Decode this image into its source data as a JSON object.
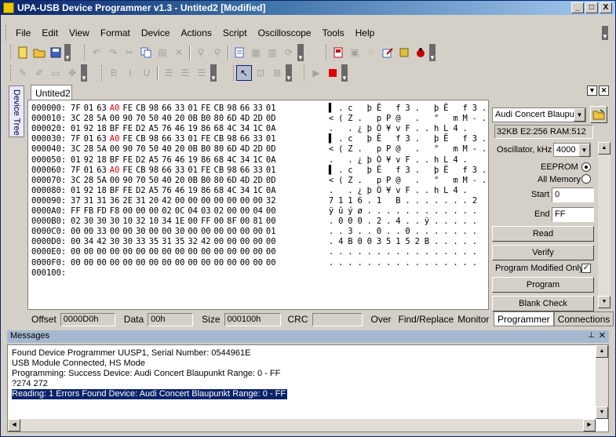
{
  "window": {
    "title": "UPA-USB Device Programmer v1.3 - Untited2 [Modified]",
    "min": "_",
    "max": "□",
    "close": "X"
  },
  "menu": [
    "File",
    "Edit",
    "View",
    "Format",
    "Device",
    "Actions",
    "Script",
    "Oscilloscope",
    "Tools",
    "Help"
  ],
  "sidebar_tab": "Device Tree",
  "doc_tab": "Untited2",
  "hex": {
    "rows": [
      {
        "addr": "000000:",
        "bytes": [
          "7F",
          "01",
          "63",
          "A0",
          "FE",
          "CB",
          "98",
          "66",
          "33",
          "01",
          "FE",
          "CB",
          "98",
          "66",
          "33",
          "01"
        ],
        "hl": [
          3
        ],
        "ascii": [
          "▌",
          ".",
          "c",
          " ",
          "þ",
          "Ë",
          " ",
          "f",
          "3",
          ".",
          " ",
          "þ",
          "Ë",
          " ",
          "f",
          "3",
          "."
        ]
      },
      {
        "addr": "000010:",
        "bytes": [
          "3C",
          "28",
          "5A",
          "00",
          "90",
          "70",
          "50",
          "40",
          "20",
          "0B",
          "B0",
          "80",
          "6D",
          "4D",
          "2D",
          "0D"
        ],
        "hl": [],
        "ascii": [
          "<",
          "(",
          "Z",
          ".",
          " ",
          "p",
          "P",
          "@",
          " ",
          ".",
          " ",
          "°",
          " ",
          "m",
          "M",
          "-",
          "."
        ]
      },
      {
        "addr": "000020:",
        "bytes": [
          "01",
          "92",
          "18",
          "BF",
          "FE",
          "D2",
          "A5",
          "76",
          "46",
          "19",
          "86",
          "68",
          "4C",
          "34",
          "1C",
          "0A"
        ],
        "hl": [],
        "ascii": [
          ".",
          " ",
          ".",
          "¿",
          "þ",
          "Ò",
          "¥",
          "v",
          "F",
          ".",
          ".",
          "h",
          "L",
          "4",
          ".",
          " "
        ]
      },
      {
        "addr": "000030:",
        "bytes": [
          "7F",
          "01",
          "63",
          "A0",
          "FE",
          "CB",
          "98",
          "66",
          "33",
          "01",
          "FE",
          "CB",
          "98",
          "66",
          "33",
          "01"
        ],
        "hl": [
          3
        ],
        "ascii": [
          "▌",
          ".",
          "c",
          " ",
          "þ",
          "Ë",
          " ",
          "f",
          "3",
          ".",
          " ",
          "þ",
          "Ë",
          " ",
          "f",
          "3",
          "."
        ]
      },
      {
        "addr": "000040:",
        "bytes": [
          "3C",
          "28",
          "5A",
          "00",
          "90",
          "70",
          "50",
          "40",
          "20",
          "0B",
          "B0",
          "80",
          "6D",
          "4D",
          "2D",
          "0D"
        ],
        "hl": [],
        "ascii": [
          "<",
          "(",
          "Z",
          ".",
          " ",
          "p",
          "P",
          "@",
          " ",
          ".",
          " ",
          "°",
          " ",
          "m",
          "M",
          "-",
          "."
        ]
      },
      {
        "addr": "000050:",
        "bytes": [
          "01",
          "92",
          "18",
          "BF",
          "FE",
          "D2",
          "A5",
          "76",
          "46",
          "19",
          "86",
          "68",
          "4C",
          "34",
          "1C",
          "0A"
        ],
        "hl": [],
        "ascii": [
          ".",
          " ",
          ".",
          "¿",
          "þ",
          "Ò",
          "¥",
          "v",
          "F",
          ".",
          ".",
          "h",
          "L",
          "4",
          ".",
          " "
        ]
      },
      {
        "addr": "000060:",
        "bytes": [
          "7F",
          "01",
          "63",
          "A0",
          "FE",
          "CB",
          "98",
          "66",
          "33",
          "01",
          "FE",
          "CB",
          "98",
          "66",
          "33",
          "01"
        ],
        "hl": [
          3
        ],
        "ascii": [
          "▌",
          ".",
          "c",
          " ",
          "þ",
          "Ë",
          " ",
          "f",
          "3",
          ".",
          " ",
          "þ",
          "Ë",
          " ",
          "f",
          "3",
          "."
        ]
      },
      {
        "addr": "000070:",
        "bytes": [
          "3C",
          "28",
          "5A",
          "00",
          "90",
          "70",
          "50",
          "40",
          "20",
          "0B",
          "B0",
          "80",
          "6D",
          "4D",
          "2D",
          "0D"
        ],
        "hl": [],
        "ascii": [
          "<",
          "(",
          "Z",
          ".",
          " ",
          "p",
          "P",
          "@",
          " ",
          ".",
          " ",
          "°",
          " ",
          "m",
          "M",
          "-",
          "."
        ]
      },
      {
        "addr": "000080:",
        "bytes": [
          "01",
          "92",
          "18",
          "BF",
          "FE",
          "D2",
          "A5",
          "76",
          "46",
          "19",
          "86",
          "68",
          "4C",
          "34",
          "1C",
          "0A"
        ],
        "hl": [],
        "ascii": [
          ".",
          " ",
          ".",
          "¿",
          "þ",
          "Ò",
          "¥",
          "v",
          "F",
          ".",
          ".",
          "h",
          "L",
          "4",
          ".",
          " "
        ]
      },
      {
        "addr": "000090:",
        "bytes": [
          "37",
          "31",
          "31",
          "36",
          "2E",
          "31",
          "20",
          "42",
          "00",
          "00",
          "00",
          "00",
          "00",
          "00",
          "00",
          "32"
        ],
        "hl": [],
        "ascii": [
          "7",
          "1",
          "1",
          "6",
          ".",
          "1",
          " ",
          "B",
          ".",
          ".",
          ".",
          ".",
          ".",
          ".",
          ".",
          "2"
        ]
      },
      {
        "addr": "0000A0:",
        "bytes": [
          "FF",
          "FB",
          "FD",
          "F8",
          "00",
          "00",
          "00",
          "02",
          "0C",
          "04",
          "03",
          "02",
          "00",
          "00",
          "04",
          "00"
        ],
        "hl": [],
        "ascii": [
          "ÿ",
          "û",
          "ý",
          "ø",
          ".",
          ".",
          ".",
          ".",
          ".",
          ".",
          ".",
          ".",
          ".",
          ".",
          ".",
          "."
        ]
      },
      {
        "addr": "0000B0:",
        "bytes": [
          "02",
          "30",
          "30",
          "30",
          "10",
          "32",
          "10",
          "34",
          "1E",
          "00",
          "FF",
          "00",
          "8F",
          "00",
          "81",
          "00"
        ],
        "hl": [],
        "ascii": [
          ".",
          "0",
          "0",
          "0",
          ".",
          "2",
          ".",
          "4",
          ".",
          ".",
          "ÿ",
          ".",
          ".",
          ".",
          ".",
          "."
        ]
      },
      {
        "addr": "0000C0:",
        "bytes": [
          "00",
          "00",
          "33",
          "00",
          "00",
          "30",
          "00",
          "00",
          "30",
          "00",
          "00",
          "00",
          "00",
          "00",
          "00",
          "01"
        ],
        "hl": [],
        "ascii": [
          ".",
          ".",
          "3",
          ".",
          ".",
          "0",
          ".",
          ".",
          "0",
          ".",
          ".",
          ".",
          ".",
          ".",
          ".",
          "."
        ]
      },
      {
        "addr": "0000D0:",
        "bytes": [
          "00",
          "34",
          "42",
          "30",
          "30",
          "33",
          "35",
          "31",
          "35",
          "32",
          "42",
          "00",
          "00",
          "00",
          "00",
          "00"
        ],
        "hl": [],
        "ascii": [
          ".",
          "4",
          "B",
          "0",
          "0",
          "3",
          "5",
          "1",
          "5",
          "2",
          "B",
          ".",
          ".",
          ".",
          ".",
          "."
        ]
      },
      {
        "addr": "0000E0:",
        "bytes": [
          "00",
          "00",
          "00",
          "00",
          "00",
          "00",
          "00",
          "00",
          "00",
          "00",
          "00",
          "00",
          "00",
          "00",
          "00",
          "00"
        ],
        "hl": [],
        "ascii": [
          ".",
          ".",
          ".",
          ".",
          ".",
          ".",
          ".",
          ".",
          ".",
          ".",
          ".",
          ".",
          ".",
          ".",
          ".",
          "."
        ]
      },
      {
        "addr": "0000F0:",
        "bytes": [
          "00",
          "00",
          "00",
          "00",
          "00",
          "00",
          "00",
          "00",
          "00",
          "00",
          "00",
          "00",
          "00",
          "00",
          "00",
          "00"
        ],
        "hl": [],
        "ascii": [
          ".",
          ".",
          ".",
          ".",
          ".",
          ".",
          ".",
          ".",
          ".",
          ".",
          ".",
          ".",
          ".",
          ".",
          ".",
          "."
        ]
      },
      {
        "addr": "000100:",
        "bytes": [],
        "hl": [],
        "ascii": []
      }
    ]
  },
  "statusbar": {
    "offset_label": "Offset",
    "offset_value": "0000D0h",
    "data_label": "Data",
    "data_value": "00h",
    "size_label": "Size",
    "size_value": "000100h",
    "crc_label": "CRC",
    "crc_value": "",
    "over": "Over",
    "find_replace": "Find/Replace",
    "monitor": "Monitor"
  },
  "device": {
    "selected": "Audi Concert Blaupu",
    "info": "32KB E2:256 RAM:512",
    "osc_label": "Oscillator, kHz",
    "osc_value": "4000",
    "eeprom_label": "EEPROM",
    "allmem_label": "All Memory",
    "start_label": "Start",
    "start_value": "0",
    "end_label": "End",
    "end_value": "FF",
    "read": "Read",
    "verify": "Verify",
    "prog_modified_label": "Program Modified Only",
    "program": "Program",
    "blank_check": "Blank Check"
  },
  "bottom_tabs": [
    "Programmer",
    "Connections"
  ],
  "messages": {
    "title": "Messages",
    "lines": [
      "Found Device Programmer UUSP1, Serial Number: 0544961E",
      "USB Module Connected, HS Mode",
      "Programming: Success  Device: Audi Concert Blaupunkt Range: 0 - FF",
      "?274 272",
      "Reading:  1 Errors Found   Device: Audi Concert Blaupunkt Range: 0 - FF"
    ]
  }
}
